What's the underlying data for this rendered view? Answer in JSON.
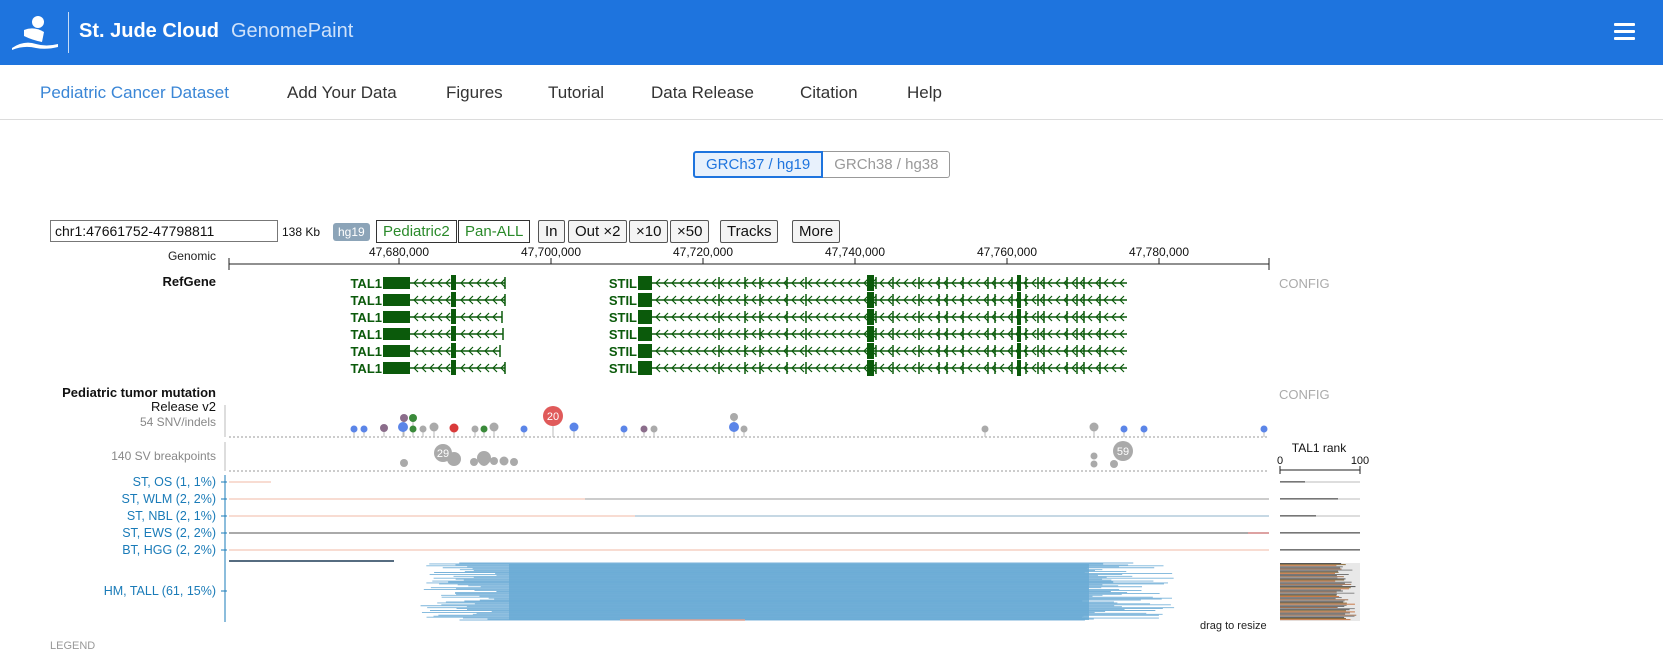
{
  "header": {
    "brand": "St. Jude Cloud",
    "product": "GenomePaint",
    "logo_icon": "st-jude-figure-icon",
    "menu_icon": "hamburger-menu-icon"
  },
  "nav": {
    "items": [
      "Pediatric Cancer Dataset",
      "Add Your Data",
      "Figures",
      "Tutorial",
      "Data Release",
      "Citation",
      "Help"
    ],
    "active": "Pediatric Cancer Dataset"
  },
  "genome_toggle": {
    "options": [
      "GRCh37 / hg19",
      "GRCh38 / hg38"
    ],
    "selected": "GRCh37 / hg19"
  },
  "toolbar": {
    "coord_value": "chr1:47661752-47798811",
    "span": "138 Kb",
    "genome_badge": "hg19",
    "datasets": [
      "Pediatric2",
      "Pan-ALL"
    ],
    "zoom_in": "In",
    "zoom_out": "Out ×2",
    "zoom_x10": "×10",
    "zoom_x50": "×50",
    "tracks": "Tracks",
    "more": "More"
  },
  "ruler": {
    "label": "Genomic",
    "ticks": [
      "47,680,000",
      "47,700,000",
      "47,720,000",
      "47,740,000",
      "47,760,000",
      "47,780,000"
    ]
  },
  "refgene": {
    "label": "RefGene",
    "config": "CONFIG",
    "genes": [
      {
        "name": "TAL1",
        "isoforms": 6
      },
      {
        "name": "STIL",
        "isoforms": 6
      }
    ],
    "colors": {
      "gene": "#0b5a0b"
    }
  },
  "mutation": {
    "title": "Pediatric tumor mutation",
    "release": "Release v2",
    "config": "CONFIG",
    "snv_label": "54 SNV/indels",
    "sv_label": "140 SV breakpoints",
    "snv_hotspot_count": "20",
    "sv_cluster_counts": [
      "29",
      "59"
    ],
    "colors": {
      "missense": "#5b85e8",
      "truncating": "#d93a3a",
      "silent": "#aaaaaa",
      "inframe": "#8b6d8b",
      "splice": "#3a8a3a",
      "hotspot": "#e05a5a"
    }
  },
  "rank_panel": {
    "title": "TAL1 rank",
    "min": "0",
    "max": "100"
  },
  "samples": {
    "groups": [
      {
        "label": "ST, OS (1, 1%)"
      },
      {
        "label": "ST, WLM (2, 2%)"
      },
      {
        "label": "ST, NBL (2, 1%)"
      },
      {
        "label": "ST, EWS (2, 2%)"
      },
      {
        "label": "BT, HGG (2, 2%)"
      },
      {
        "label": "HM, TALL (61, 15%)"
      }
    ],
    "colors": {
      "label": "#1a7bb8",
      "expression_bar": "#6aaad5",
      "low": "#f0b8a4"
    }
  },
  "footer": {
    "drag_resize": "drag to resize",
    "legend": "LEGEND"
  }
}
